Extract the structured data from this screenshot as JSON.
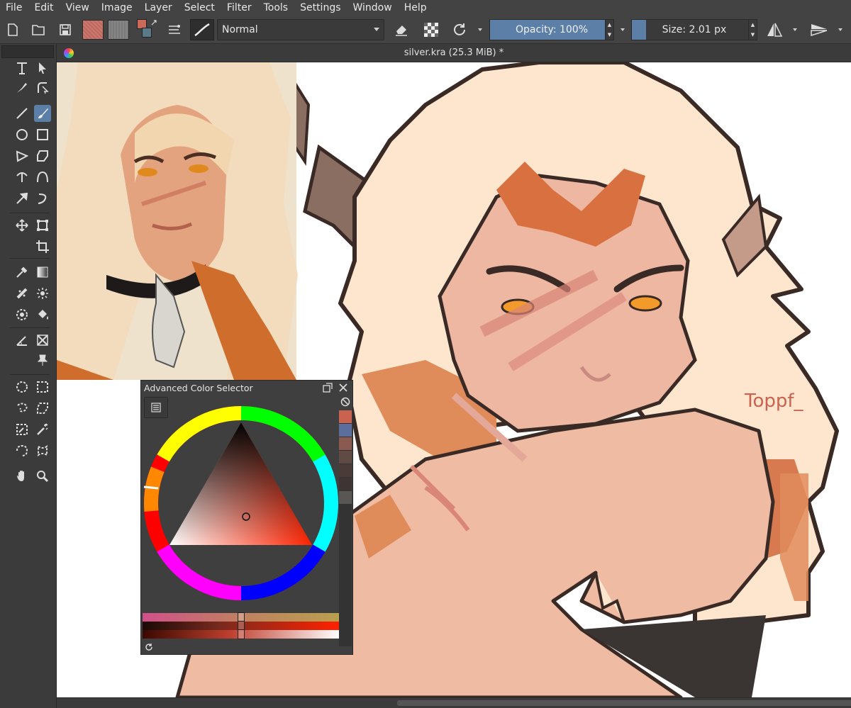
{
  "menubar": {
    "items": [
      "File",
      "Edit",
      "View",
      "Image",
      "Layer",
      "Select",
      "Filter",
      "Tools",
      "Settings",
      "Window",
      "Help"
    ]
  },
  "toolbar": {
    "blend_mode": "Normal",
    "opacity_label": "Opacity: 100%",
    "opacity_value": 100,
    "size_label": "Size: 2.01 px",
    "foreground_color": "#c96a5a",
    "background_color": "#5a7a8a"
  },
  "document": {
    "title": "silver.kra (25.3 MiB) *"
  },
  "color_selector": {
    "title": "Advanced Color Selector",
    "recent_colors": [
      "#c9634f",
      "#5b6e9c",
      "#8a5a50",
      "#5f4a44",
      "#4a3a38",
      "#3d3433",
      "#5a5654"
    ],
    "current_color": "#d8402a"
  },
  "canvas": {
    "signature": "Toppf_"
  }
}
